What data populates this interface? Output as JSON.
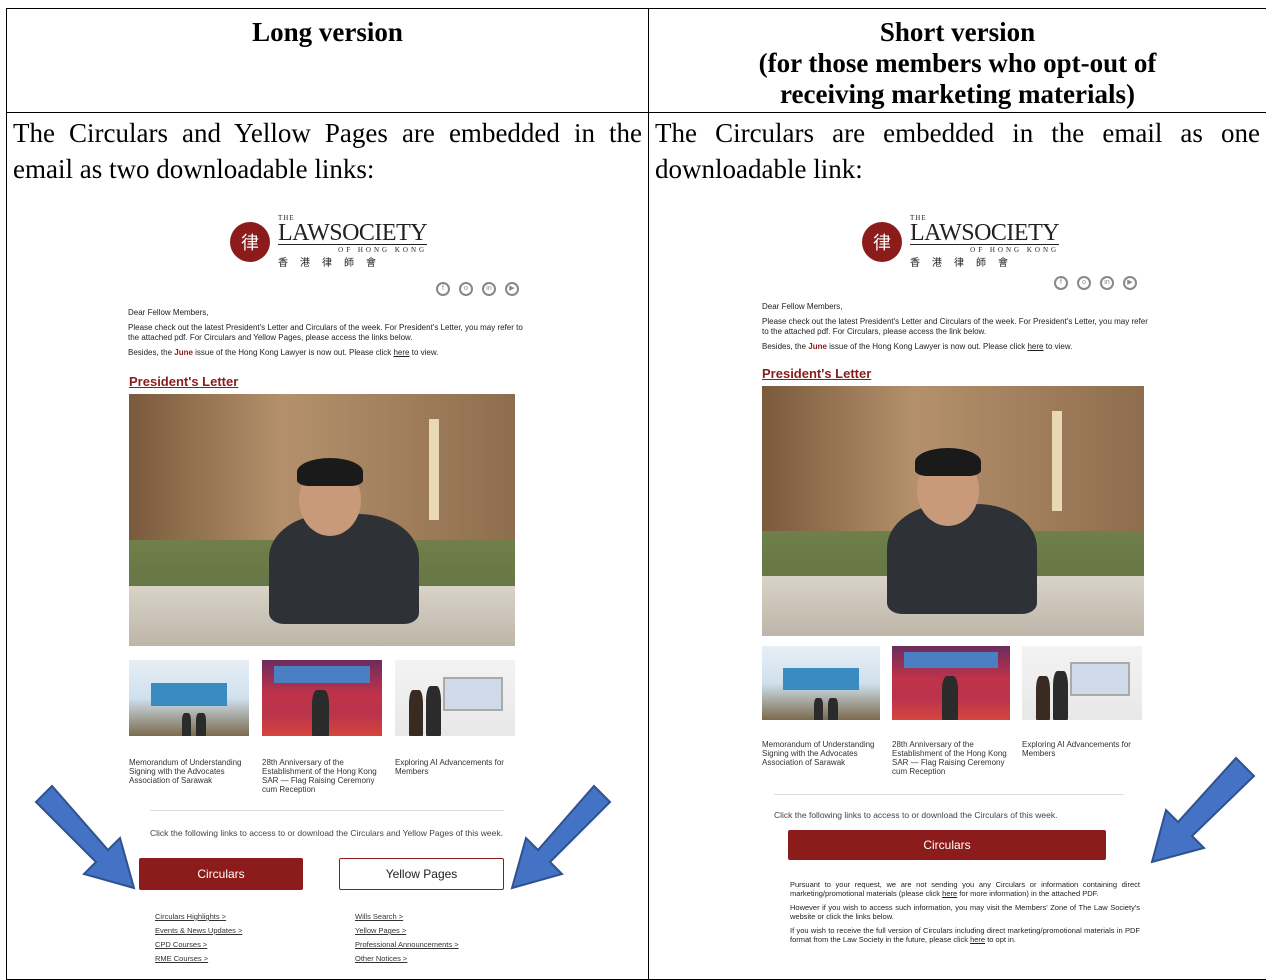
{
  "headers": {
    "long": "Long version",
    "short_line1": "Short version",
    "short_line2": "(for those members who opt-out of",
    "short_line3": "receiving marketing materials)"
  },
  "intros": {
    "long": "The Circulars and Yellow Pages are embedded in the email as two downloadable links:",
    "short": "The Circulars are embedded in the email as one downloadable link:"
  },
  "logo": {
    "the": "THE",
    "main": "LAWSOCIETY",
    "sub": "OF HONG KONG",
    "chinese": "香港律師會"
  },
  "email_long": {
    "greeting": "Dear Fellow Members,",
    "para1": "Please check out the latest President's Letter and Circulars of the week. For President's Letter, you may refer to the attached pdf.  For Circulars and Yellow Pages, please access the links below.",
    "para2_pre": "Besides, the ",
    "para2_month": "June",
    "para2_mid": " issue of the Hong Kong Lawyer is now out. Please click ",
    "para2_link": "here",
    "para2_post": " to view.",
    "pres_title": "President's Letter",
    "captions": [
      "Memorandum of Understanding Signing with the Advocates Association of Sarawak",
      "28th Anniversary of the Establishment of the Hong Kong SAR — Flag Raising Ceremony cum Reception",
      "Exploring AI Advancements for Members"
    ],
    "links_note": "Click the following links to access to or download the Circulars and Yellow Pages of this week.",
    "btn_circulars": "Circulars",
    "btn_yellow": "Yellow Pages",
    "left_links": [
      "Circulars Highlights >",
      "Events & News Updates >",
      "CPD Courses >",
      "RME Courses >"
    ],
    "right_links": [
      "Wills Search >",
      "Yellow Pages >",
      "Professional Announcements >",
      "Other Notices >"
    ]
  },
  "email_short": {
    "greeting": "Dear Fellow Members,",
    "para1": "Please check out the latest President's Letter and Circulars of the week. For President's Letter, you may refer to the attached pdf.  For Circulars, please access the link below.",
    "para2_pre": "Besides, the ",
    "para2_month": "June",
    "para2_mid": " issue of the Hong Kong Lawyer is now out. Please click ",
    "para2_link": "here",
    "para2_post": " to view.",
    "pres_title": "President's Letter",
    "captions": [
      "Memorandum of Understanding Signing with the Advocates Association of Sarawak",
      "28th Anniversary of the Establishment of the Hong Kong SAR — Flag Raising Ceremony cum Reception",
      "Exploring AI Advancements for Members"
    ],
    "links_note": "Click the following links to access to or download the Circulars of this week.",
    "btn_circulars": "Circulars",
    "optout1_pre": "Pursuant to your request, we are not sending you any Circulars or information containing direct marketing/promotional materials (please click ",
    "optout1_link": "here",
    "optout1_post": " for more information) in the attached PDF.",
    "optout2": "However if you wish to access such information, you may visit the Members' Zone of The Law Society's website or click the links below.",
    "optout3_pre": "If you wish to receive the full version of Circulars including direct marketing/promotional materials in PDF format from the Law Society in the future, please click ",
    "optout3_link": "here",
    "optout3_post": " to opt in."
  },
  "colors": {
    "brand": "#8c1c1c",
    "arrow": "#4472c4"
  }
}
